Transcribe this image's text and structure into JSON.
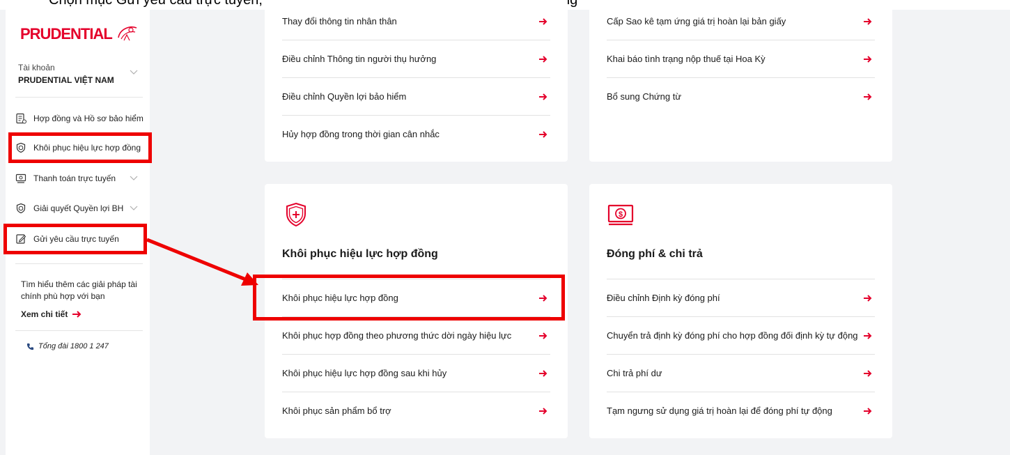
{
  "caption": "Chọn mục Gửi yêu cầu trực tuyến, sau đó chọn yêu cầu Khôi phục hiệu lực hợp đồng",
  "brand": {
    "logo_text": "PRUDENTIAL",
    "accent": "#e4002b",
    "highlight": "#ee0000"
  },
  "account": {
    "label": "Tài khoản",
    "name": "PRUDENTIAL VIỆT NAM"
  },
  "sidebar": {
    "items": [
      {
        "label": "Hợp đồng và Hồ sơ bảo hiểm",
        "icon": "document-icon"
      },
      {
        "label": "Khôi phục hiệu lực hợp đồng",
        "icon": "shield-icon"
      },
      {
        "label": "Thanh toán trực tuyến",
        "icon": "payment-icon"
      },
      {
        "label": "Giải quyết Quyền lợi BH",
        "icon": "shield-icon"
      },
      {
        "label": "Gửi yêu cầu trực tuyến",
        "icon": "edit-icon"
      }
    ],
    "promo_text": "Tìm hiểu thêm các giải pháp tài chính phù hợp với bạn",
    "more_link": "Xem chi tiết",
    "hotline": "Tổng đài 1800 1 247"
  },
  "cards": {
    "top_left": {
      "rows": [
        "Thay đổi thông tin nhân thân",
        "Điều chỉnh Thông tin người thụ hưởng",
        "Điều chỉnh Quyền lợi bảo hiểm",
        "Hủy hợp đồng trong thời gian cân nhắc"
      ]
    },
    "top_right": {
      "rows": [
        "Cấp Sao kê tạm ứng giá trị hoàn lại bản giấy",
        "Khai báo tình trạng nộp thuế tại Hoa Kỳ",
        "Bổ sung Chứng từ"
      ]
    },
    "reinstate": {
      "icon": "shield-plus-icon",
      "title": "Khôi phục hiệu lực hợp đồng",
      "rows": [
        "Khôi phục hiệu lực hợp đồng",
        "Khôi phục hợp đồng theo phương thức dời ngày hiệu lực",
        "Khôi phục hiệu lực hợp đồng sau khi hủy",
        "Khôi phục sản phẩm bổ trợ"
      ]
    },
    "payment": {
      "icon": "money-icon",
      "title": "Đóng phí & chi trả",
      "rows": [
        "Điều chỉnh Định kỳ đóng phí",
        "Chuyển trả định kỳ đóng phí cho hợp đồng đối định kỳ tự động",
        "Chi trả phí dư",
        "Tạm ngưng sử dụng giá trị hoàn lại để đóng phí tự động"
      ]
    }
  }
}
